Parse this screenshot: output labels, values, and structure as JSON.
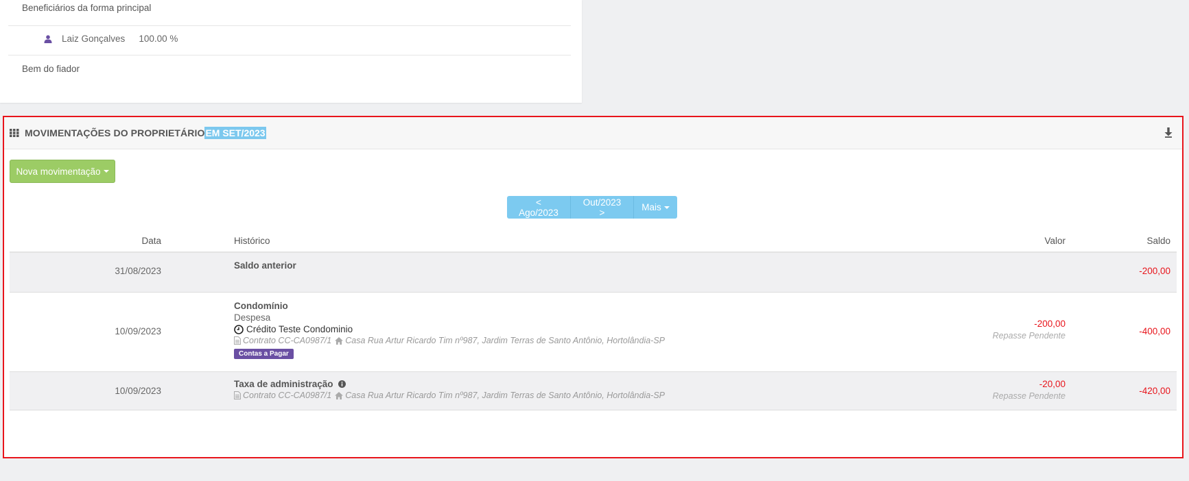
{
  "top_card": {
    "beneficiarios_label": "Beneficiários da forma principal",
    "beneficiary": {
      "name": "Laiz Gonçalves",
      "percent": "100.00 %"
    },
    "bem_label": "Bem do fiador"
  },
  "panel": {
    "title": "MOVIMENTAÇÕES DO PROPRIETÁRIO",
    "title_period": "EM SET/2023",
    "nova_button": "Nova movimentação",
    "nav": {
      "prev": "< Ago/2023",
      "next": "Out/2023 >",
      "more": "Mais"
    },
    "columns": {
      "data": "Data",
      "historico": "Histórico",
      "valor": "Valor",
      "saldo": "Saldo"
    },
    "rows": [
      {
        "date": "31/08/2023",
        "title": "Saldo anterior",
        "saldo": "-200,00"
      },
      {
        "date": "10/09/2023",
        "title": "Condomínio",
        "subtitle": "Despesa",
        "credit": "Crédito Teste Condominio",
        "contract": "Contrato CC-CA0987/1",
        "address": "Casa Rua Artur Ricardo Tim nº987, Jardim Terras de Santo Antônio, Hortolândia-SP",
        "badge": "Contas a Pagar",
        "valor": "-200,00",
        "valor_status": "Repasse Pendente",
        "saldo": "-400,00"
      },
      {
        "date": "10/09/2023",
        "title": "Taxa de administração",
        "contract": "Contrato CC-CA0987/1",
        "address": "Casa Rua Artur Ricardo Tim nº987, Jardim Terras de Santo Antônio, Hortolândia-SP",
        "valor": "-20,00",
        "valor_status": "Repasse Pendente",
        "saldo": "-420,00"
      }
    ]
  },
  "colors": {
    "accent_green": "#9ccc65",
    "accent_blue": "#7ccaf0",
    "negative": "#e8141b",
    "badge_purple": "#6a4fa3",
    "highlight_border": "#e8141b"
  }
}
